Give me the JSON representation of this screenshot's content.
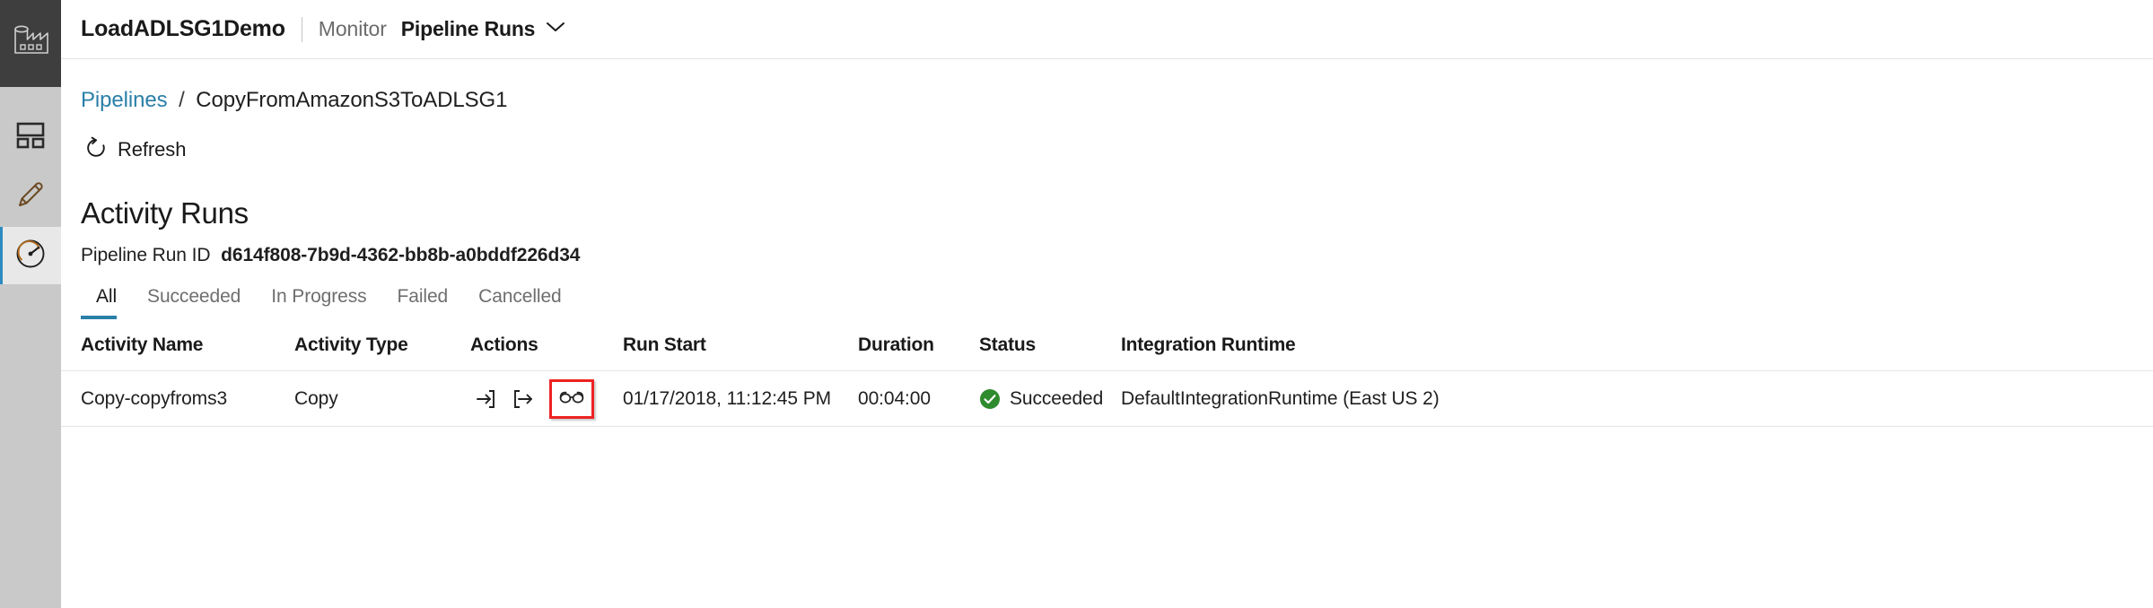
{
  "sidebar": {
    "logo_icon": "factory-icon",
    "items": [
      {
        "name": "home",
        "icon": "dashboard-icon",
        "active": false
      },
      {
        "name": "author",
        "icon": "pencil-icon",
        "active": false
      },
      {
        "name": "monitor",
        "icon": "gauge-icon",
        "active": true
      }
    ],
    "accent_color": "#2e8bc0",
    "logo_bg": "#3e3e3e",
    "rail_bg": "#c9c9c9"
  },
  "header": {
    "app_title": "LoadADLSG1Demo",
    "section": "Monitor",
    "page": "Pipeline Runs",
    "chevron_icon": "chevron-down-icon"
  },
  "breadcrumb": {
    "root": "Pipelines",
    "separator": "/",
    "current": "CopyFromAmazonS3ToADLSG1",
    "link_color": "#2a7fa8"
  },
  "toolbar": {
    "refresh_label": "Refresh",
    "refresh_icon": "refresh-icon"
  },
  "section": {
    "title": "Activity Runs",
    "run_id_label": "Pipeline Run ID",
    "run_id_value": "d614f808-7b9d-4362-bb8b-a0bddf226d34"
  },
  "tabs": {
    "items": [
      {
        "label": "All",
        "active": true
      },
      {
        "label": "Succeeded",
        "active": false
      },
      {
        "label": "In Progress",
        "active": false
      },
      {
        "label": "Failed",
        "active": false
      },
      {
        "label": "Cancelled",
        "active": false
      }
    ],
    "active_underline_color": "#2a7fa8"
  },
  "table": {
    "columns": [
      "Activity Name",
      "Activity Type",
      "Actions",
      "Run Start",
      "Duration",
      "Status",
      "Integration Runtime"
    ],
    "rows": [
      {
        "activity_name": "Copy-copyfroms3",
        "activity_type": "Copy",
        "actions": [
          {
            "name": "input-icon",
            "highlighted": false
          },
          {
            "name": "output-icon",
            "highlighted": false
          },
          {
            "name": "details-glasses-icon",
            "highlighted": true
          }
        ],
        "run_start": "01/17/2018, 11:12:45 PM",
        "duration": "00:04:00",
        "status": "Succeeded",
        "status_icon": "success-check-icon",
        "status_color": "#2e8b2e",
        "integration_runtime": "DefaultIntegrationRuntime (East US 2)"
      }
    ],
    "highlight_box_color": "#ee2222"
  }
}
